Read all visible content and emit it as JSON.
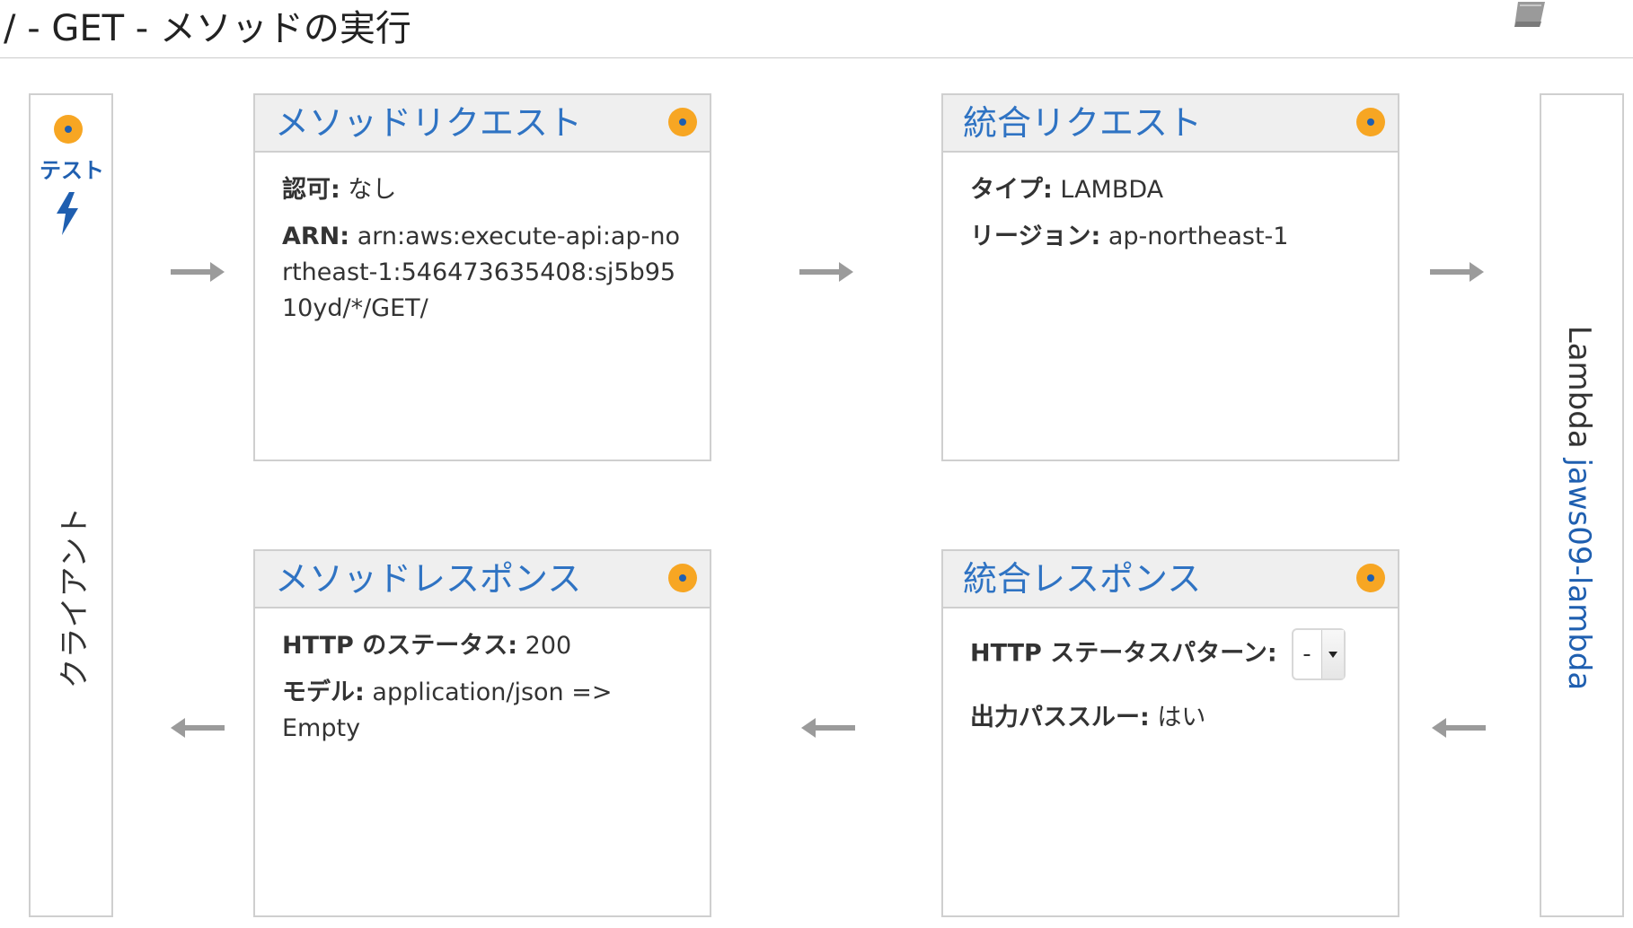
{
  "page": {
    "title": "/ - GET - メソッドの実行"
  },
  "icons": {
    "docs": "book-icon",
    "status": "orange-dot-icon",
    "test": "lightning-bolt-icon",
    "arrow_right": "arrow-right-icon",
    "arrow_left": "arrow-left-icon"
  },
  "colors": {
    "link_blue": "#2f73c3",
    "accent_orange": "#f7a623",
    "header_gray": "#efefef",
    "border_gray": "#cfcfcf"
  },
  "client": {
    "test_label": "テスト",
    "label": "クライアント"
  },
  "method_request": {
    "title": "メソッドリクエスト",
    "auth_label": "認可:",
    "auth_value": "なし",
    "arn_label": "ARN:",
    "arn_value": "arn:aws:execute-api:ap-northeast-1:546473635408:sj5b9510yd/*/GET/"
  },
  "integration_request": {
    "title": "統合リクエスト",
    "type_label": "タイプ:",
    "type_value": "LAMBDA",
    "region_label": "リージョン:",
    "region_value": "ap-northeast-1"
  },
  "method_response": {
    "title": "メソッドレスポンス",
    "status_label": "HTTP のステータス:",
    "status_value": "200",
    "model_label": "モデル:",
    "model_value": "application/json => Empty"
  },
  "integration_response": {
    "title": "統合レスポンス",
    "pattern_label": "HTTP ステータスパターン:",
    "pattern_value": "-",
    "passthrough_label": "出力パススルー:",
    "passthrough_value": "はい"
  },
  "lambda": {
    "prefix": "Lambda",
    "function_name": "jaws09-lambda"
  }
}
